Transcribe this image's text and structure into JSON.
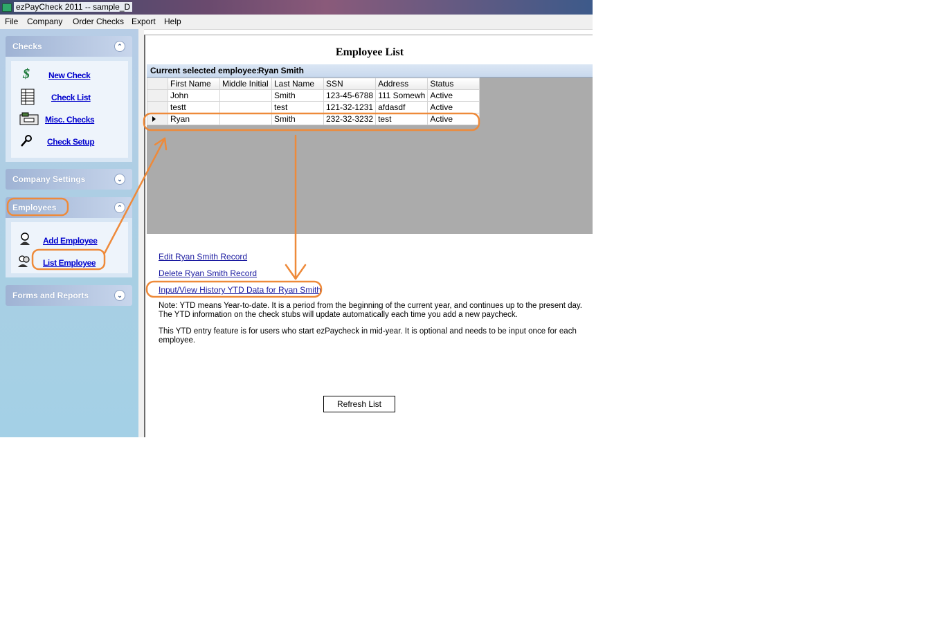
{
  "window": {
    "title": "ezPayCheck 2011 -- sample_D"
  },
  "menu": [
    "File",
    "Company",
    "Order Checks",
    "Export",
    "Help"
  ],
  "sidebar": {
    "checks": {
      "title": "Checks",
      "items": [
        "New Check",
        "Check List",
        "Misc. Checks",
        "Check Setup"
      ]
    },
    "company_settings": {
      "title": "Company Settings"
    },
    "employees": {
      "title": "Employees",
      "items": [
        "Add Employee",
        "List Employee"
      ]
    },
    "forms_reports": {
      "title": "Forms and Reports"
    }
  },
  "main": {
    "title": "Employee List",
    "caption_label": "Current selected employee:",
    "caption_value": "Ryan Smith",
    "columns": [
      "First Name",
      "Middle Initial",
      "Last Name",
      "SSN",
      "Address",
      "Status"
    ],
    "rows": [
      [
        "John",
        "",
        "Smith",
        "123-45-6788",
        "111 Somewh",
        "Active"
      ],
      [
        "testt",
        "",
        "test",
        "121-32-1231",
        "afdasdf",
        "Active"
      ],
      [
        "Ryan",
        "",
        "Smith",
        "232-32-3232",
        "test",
        "Active"
      ]
    ],
    "links": {
      "edit": "Edit Ryan Smith Record",
      "delete": "Delete Ryan Smith Record",
      "ytd": "Input/View History YTD Data for Ryan Smith"
    },
    "note1": "Note: YTD means Year-to-date. It is a period from the beginning of the current year, and continues up to the present day. The YTD information on the check stubs will update automatically each time you add a new paycheck.",
    "note2": "This YTD entry feature is for users who start ezPaycheck in mid-year. It is optional and needs to be input once for each employee.",
    "refresh": "Refresh List"
  },
  "colors": {
    "annotation": "#ee8a3a",
    "link": "#0000cc"
  }
}
